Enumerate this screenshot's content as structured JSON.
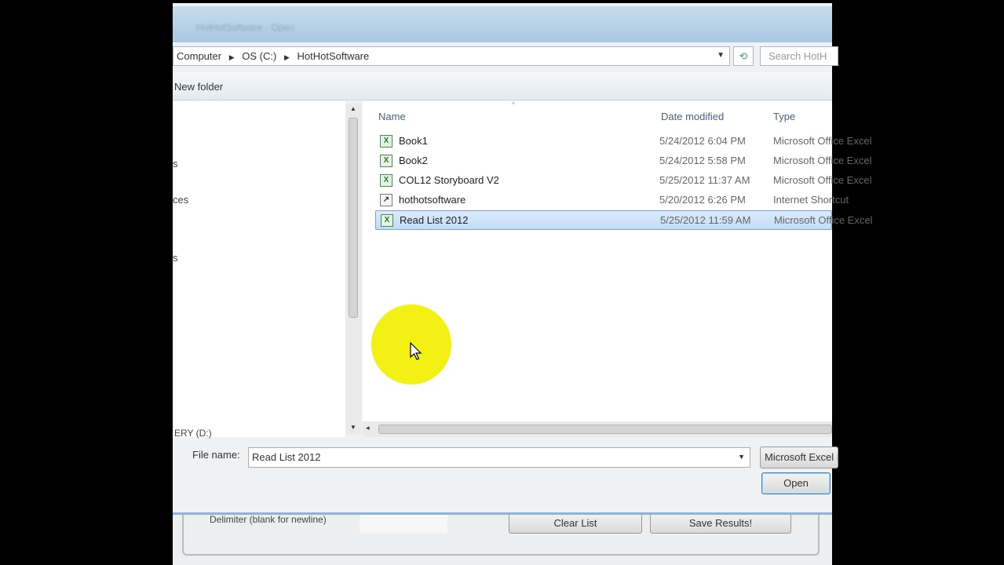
{
  "dialog": {
    "title": "HotHotSoftware - Open",
    "breadcrumb": [
      "Computer",
      "OS (C:)",
      "HotHotSoftware"
    ],
    "search_placeholder": "Search HotH",
    "toolbar": {
      "new_folder": "New folder"
    },
    "nav_fragments": [
      "es",
      "ces",
      "ERY (D:)"
    ],
    "columns": {
      "name": "Name",
      "date": "Date modified",
      "type": "Type"
    },
    "files": [
      {
        "name": "Book1",
        "date": "5/24/2012 6:04 PM",
        "type": "Microsoft Office Excel",
        "icon": "excel-icon",
        "selected": false
      },
      {
        "name": "Book2",
        "date": "5/24/2012 5:58 PM",
        "type": "Microsoft Office Excel",
        "icon": "excel-icon",
        "selected": false
      },
      {
        "name": "COL12 Storyboard V2",
        "date": "5/25/2012 11:37 AM",
        "type": "Microsoft Office Excel",
        "icon": "excel-icon",
        "selected": false
      },
      {
        "name": "hothotsoftware",
        "date": "5/20/2012 6:26 PM",
        "type": "Internet Shortcut",
        "icon": "shortcut-icon",
        "selected": false
      },
      {
        "name": "Read List 2012",
        "date": "5/25/2012 11:59 AM",
        "type": "Microsoft Office Excel",
        "icon": "excel-icon",
        "selected": true
      }
    ],
    "file_name_label": "File name:",
    "file_name_value": "Read List 2012",
    "filter_value": "Microsoft Excel Files",
    "open_button": "Open"
  },
  "background_app": {
    "delimiter_label": "Delimiter (blank for newline)",
    "clear_list": "Clear List",
    "save_results": "Save Results!"
  }
}
